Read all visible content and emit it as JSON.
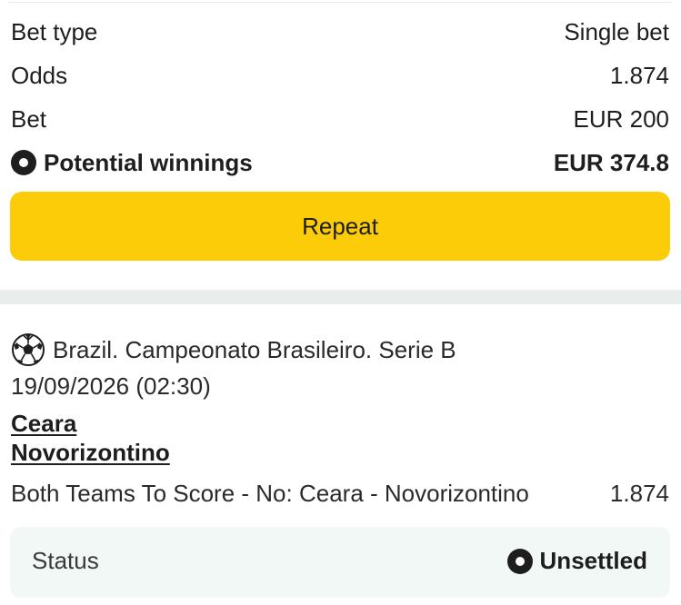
{
  "summary": {
    "bet_type": {
      "label": "Bet type",
      "value": "Single bet"
    },
    "odds": {
      "label": "Odds",
      "value": "1.874"
    },
    "bet": {
      "label": "Bet",
      "value": "EUR 200"
    },
    "potential_winnings": {
      "label": "Potential winnings",
      "value": "EUR 374.8",
      "icon": "radio-dot-icon"
    },
    "repeat_label": "Repeat",
    "accent_color": "#fccc08"
  },
  "event": {
    "sport_icon": "soccer-ball-icon",
    "league": "Brazil. Campeonato Brasileiro. Serie B",
    "datetime": "19/09/2026 (02:30)",
    "home_team": "Ceara",
    "away_team": "Novorizontino",
    "selection": "Both Teams To Score - No: Ceara - Novorizontino",
    "selection_odds": "1.874",
    "status": {
      "label": "Status",
      "value": "Unsettled",
      "icon": "radio-dot-icon"
    }
  }
}
